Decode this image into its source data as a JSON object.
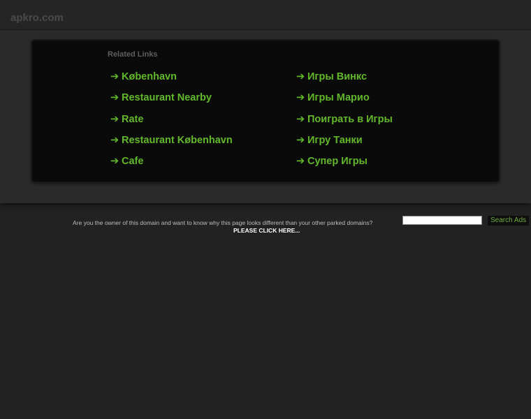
{
  "header": {
    "domain": "apkro.com"
  },
  "related": {
    "heading": "Related Links",
    "arrow": "➔",
    "left_links": [
      "København",
      "Restaurant Nearby",
      "Rate",
      "Restaurant København",
      "Cafe"
    ],
    "right_links": [
      "Игры Винкс",
      "Игры Марио",
      "Поиграть в Игры",
      "Игру Танки",
      "Супер Игры"
    ]
  },
  "footer": {
    "owner_text": "Are you the owner of this domain and want to know why this page looks different than your other parked domains?",
    "owner_link": "PLEASE CLICK HERE...",
    "search_placeholder": "",
    "search_button": "Search Ads"
  },
  "colors": {
    "background": "#222222",
    "link_green": "#62b82b",
    "panel": "#0a0a0a"
  }
}
